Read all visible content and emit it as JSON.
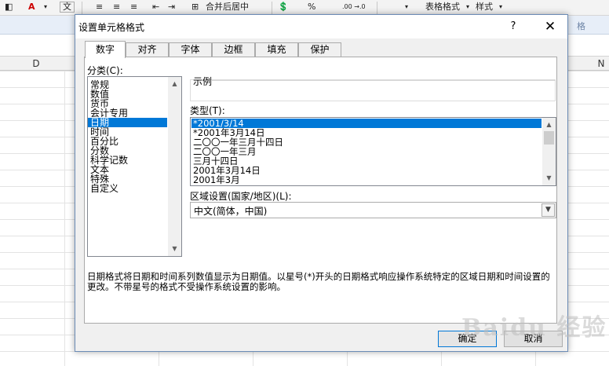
{
  "ribbon": {
    "font_a": "A",
    "wen": "文",
    "merge_center": "合并后居中",
    "percent": "%",
    "decimal": ".00 →.0",
    "table_format": "表格格式",
    "cell_style": "样式",
    "group_label": "格"
  },
  "sheet": {
    "col_d": "D",
    "col_n": "N"
  },
  "dialog": {
    "title": "设置单元格格式",
    "help": "?",
    "close": "✕",
    "tabs": [
      "数字",
      "对齐",
      "字体",
      "边框",
      "填充",
      "保护"
    ],
    "active_tab": "数字",
    "category_label": "分类(C):",
    "categories": [
      "常规",
      "数值",
      "货币",
      "会计专用",
      "日期",
      "时间",
      "百分比",
      "分数",
      "科学记数",
      "文本",
      "特殊",
      "自定义"
    ],
    "selected_category": "日期",
    "sample_label": "示例",
    "type_label": "类型(T):",
    "types": [
      "*2001/3/14",
      "*2001年3月14日",
      "二〇〇一年三月十四日",
      "二〇〇一年三月",
      "三月十四日",
      "2001年3月14日",
      "2001年3月"
    ],
    "selected_type": "*2001/3/14",
    "locale_label": "区域设置(国家/地区)(L):",
    "locale_value": "中文(简体，中国)",
    "description": "日期格式将日期和时间系列数值显示为日期值。以星号(*)开头的日期格式响应操作系统特定的区域日期和时间设置的更改。不带星号的格式不受操作系统设置的影响。",
    "ok": "确定",
    "cancel": "取消"
  },
  "watermark": "Baidu 经验",
  "colors": {
    "selection": "#0078d7",
    "dialog_bg": "#f0f0f0",
    "title_bg": "#ffffff"
  }
}
